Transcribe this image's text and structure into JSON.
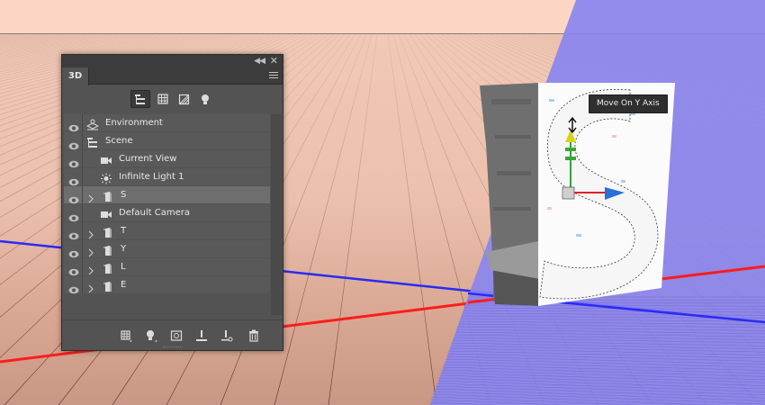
{
  "panel": {
    "tab_label": "3D",
    "toolbar_icons": [
      "scene-filter-icon",
      "mesh-filter-icon",
      "material-filter-icon",
      "light-filter-icon"
    ],
    "layers": [
      {
        "label": "Environment",
        "icon": "environment-icon",
        "expandable": false,
        "selected": false
      },
      {
        "label": "Scene",
        "icon": "scene-icon",
        "expandable": false,
        "selected": false
      },
      {
        "label": "Current View",
        "icon": "camera-icon",
        "expandable": false,
        "selected": false
      },
      {
        "label": "Infinite Light 1",
        "icon": "light-icon",
        "expandable": false,
        "selected": false
      },
      {
        "label": "S",
        "icon": "mesh-icon",
        "expandable": true,
        "selected": true
      },
      {
        "label": "Default Camera",
        "icon": "camera-icon",
        "expandable": false,
        "selected": false
      },
      {
        "label": "T",
        "icon": "mesh-icon",
        "expandable": true,
        "selected": false
      },
      {
        "label": "Y",
        "icon": "mesh-icon",
        "expandable": true,
        "selected": false
      },
      {
        "label": "L",
        "icon": "mesh-icon",
        "expandable": true,
        "selected": false
      },
      {
        "label": "E",
        "icon": "mesh-icon",
        "expandable": true,
        "selected": false
      }
    ],
    "bottom_icons": [
      "add-mesh-icon",
      "add-light-icon",
      "render-icon",
      "drop-to-plane-icon",
      "add-constraint-icon",
      "trash-icon"
    ]
  },
  "tooltip": {
    "text": "Move On Y Axis"
  },
  "colors": {
    "sky": "#fdd5c4",
    "ground": "#f1c8b6",
    "purple_plane": "#8b85ee",
    "x_axis": "#ff2020",
    "z_axis": "#2222ff",
    "panel_bg": "#535353",
    "row_selected": "#6e6e6e"
  }
}
